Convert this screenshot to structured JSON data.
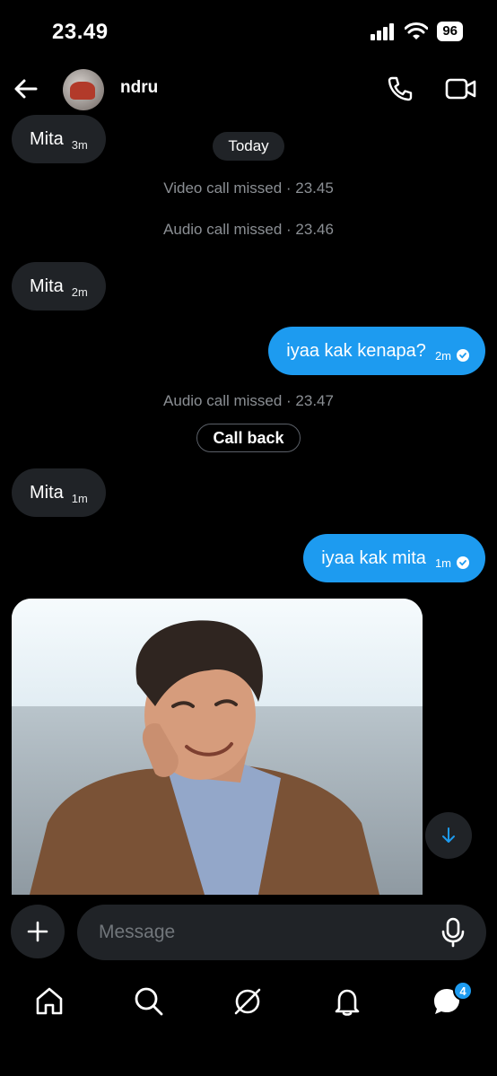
{
  "status_bar": {
    "time": "23.49",
    "battery": "96"
  },
  "header": {
    "contact_name": "ndru"
  },
  "messages": [
    {
      "type": "incoming",
      "text": "Mita",
      "time": "3m"
    },
    {
      "type": "date_pill",
      "text": "Today"
    },
    {
      "type": "system",
      "text": "Video call missed · 23.45"
    },
    {
      "type": "system",
      "text": "Audio call missed · 23.46"
    },
    {
      "type": "incoming",
      "text": "Mita",
      "time": "2m"
    },
    {
      "type": "outgoing",
      "text": "iyaa kak kenapa?",
      "time": "2m"
    },
    {
      "type": "system",
      "text": "Audio call missed · 23.47"
    },
    {
      "type": "action",
      "text": "Call back"
    },
    {
      "type": "incoming",
      "text": "Mita",
      "time": "1m"
    },
    {
      "type": "outgoing",
      "text": "iyaa kak mita",
      "time": "1m"
    }
  ],
  "composer": {
    "placeholder": "Message"
  },
  "bottom_nav": {
    "messages_badge": "4"
  },
  "colors": {
    "accent": "#1d9bf0",
    "bubble_in": "#202327",
    "background": "#000000"
  }
}
